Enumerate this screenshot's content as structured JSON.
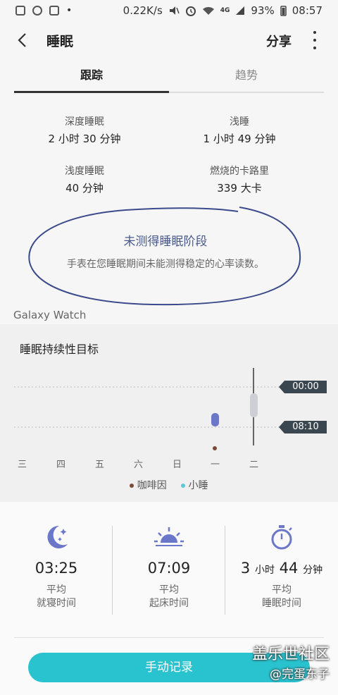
{
  "status": {
    "speed": "0.22K/s",
    "battery": "93%",
    "time": "08:57",
    "network": "4G"
  },
  "header": {
    "title": "睡眠",
    "share_label": "分享"
  },
  "tabs": [
    {
      "label": "跟踪",
      "active": true
    },
    {
      "label": "趋势",
      "active": false
    }
  ],
  "stats": {
    "deep": {
      "label": "深度睡眠",
      "value": "2 小时 30 分钟"
    },
    "light": {
      "label": "浅睡",
      "value": "1 小时 49 分钟"
    },
    "shallow": {
      "label": "浅度睡眠",
      "value": "40 分钟"
    },
    "calories": {
      "label": "燃烧的卡路里",
      "value": "339 大卡"
    }
  },
  "note": {
    "title": "未测得睡眠阶段",
    "desc": "手表在您睡眠期间未能测得稳定的心率读数。"
  },
  "source": "Galaxy Watch",
  "chart": {
    "title": "睡眠持续性目标",
    "days": [
      "三",
      "四",
      "五",
      "六",
      "日",
      "一",
      "二"
    ],
    "target_labels": [
      "00:00",
      "08:10"
    ],
    "legend": [
      {
        "label": "咖啡因",
        "color": "#7a4a3a"
      },
      {
        "label": "小睡",
        "color": "#5bc7d9"
      }
    ],
    "accent": "#6b77c9"
  },
  "summary": [
    {
      "value": "03:25",
      "caption1": "平均",
      "caption2": "就寝时间"
    },
    {
      "value": "07:09",
      "caption1": "平均",
      "caption2": "起床时间"
    },
    {
      "value_main": "3",
      "unit1": "小时",
      "value_main2": "44",
      "unit2": "分钟",
      "caption1": "平均",
      "caption2": "睡眠时间"
    }
  ],
  "manual_button": "手动记录",
  "watermark": {
    "line1": "盖乐世社区",
    "line2": "@完蛋东子"
  }
}
